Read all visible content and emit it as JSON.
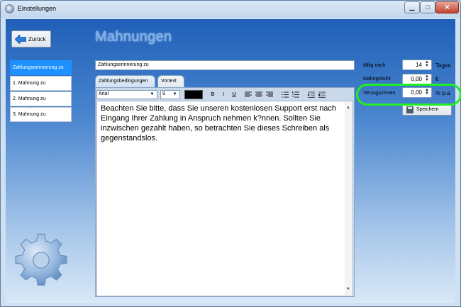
{
  "window": {
    "title": "Einstellungen",
    "minimize_icon": "minimize-icon",
    "maximize_icon": "maximize-icon",
    "close_icon": "close-icon"
  },
  "header": {
    "back_label": "Zurück",
    "page_title": "Mahnungen"
  },
  "sidebar": {
    "items": [
      {
        "label": "Zahlungserinnerung zu",
        "active": true
      },
      {
        "label": "1. Mahnung zu",
        "active": false
      },
      {
        "label": "2. Mahnung zu",
        "active": false
      },
      {
        "label": "3. Mahnung zu",
        "active": false
      }
    ]
  },
  "name_field": {
    "value": "Zahlungserinnerung zu"
  },
  "tabs": [
    {
      "label": "Zahlungsbedingungen",
      "active": true
    },
    {
      "label": "Vortext",
      "active": false
    }
  ],
  "toolbar": {
    "font": "Arial",
    "size": "9",
    "color": "#000000",
    "bold_label": "B",
    "italic_label": "I",
    "underline_label": "U"
  },
  "editor": {
    "text": "Beachten Sie bitte, dass Sie unseren kostenlosen Support erst nach Eingang Ihrer Zahlung in Anspruch nehmen k?nnen. Sollten Sie inzwischen gezahlt haben, so betrachten Sie dieses Schreiben als gegenstandslos."
  },
  "settings": {
    "faellig_label": "fällig nach",
    "faellig_value": "14",
    "faellig_unit": "Tagen",
    "gebuehr_label": "Mahngebühr",
    "gebuehr_value": "0,00",
    "gebuehr_unit": "€",
    "zinsen_label": "Verzugszinsen",
    "zinsen_value": "0,00",
    "zinsen_unit": "% p.a.",
    "save_label": "Speichern"
  },
  "colors": {
    "accent": "#1e90ff",
    "highlight": "#22ee22"
  }
}
